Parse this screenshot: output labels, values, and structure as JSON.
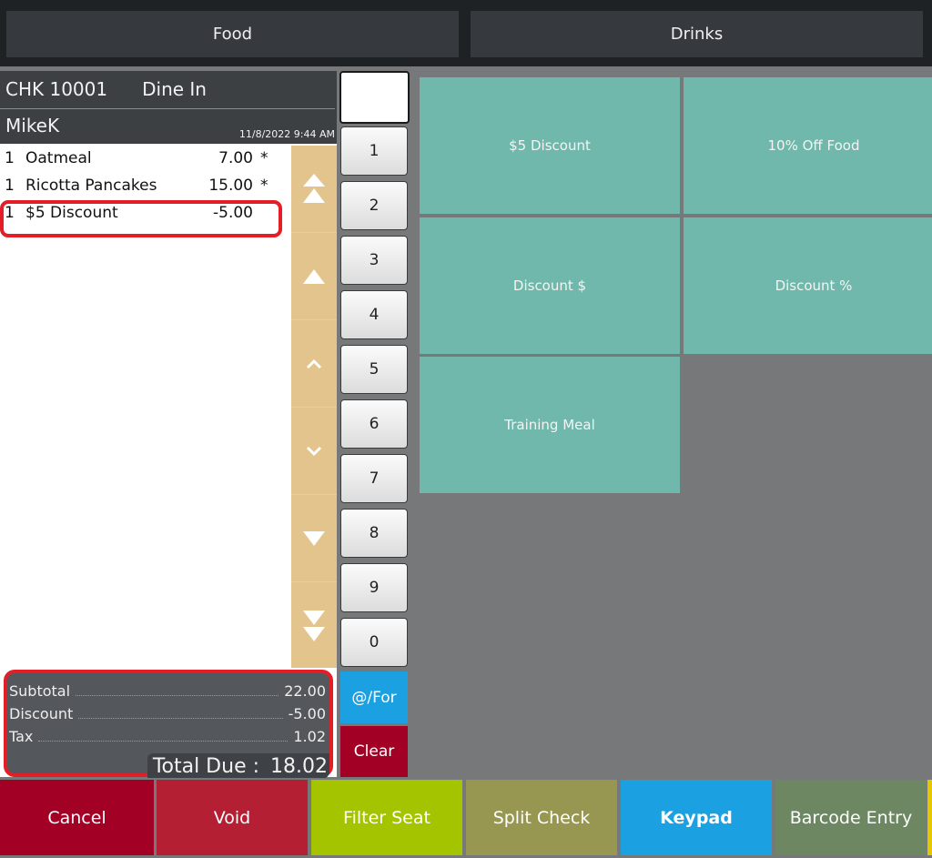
{
  "categories": {
    "food": "Food",
    "drinks": "Drinks"
  },
  "check": {
    "number": "CHK 10001",
    "order_type": "Dine In",
    "user": "MikeK",
    "datetime": "11/8/2022 9:44 AM",
    "items": [
      {
        "qty": "1",
        "name": "Oatmeal",
        "price": "7.00",
        "flag": "*"
      },
      {
        "qty": "1",
        "name": "Ricotta Pancakes",
        "price": "15.00",
        "flag": "*"
      },
      {
        "qty": "1",
        "name": "$5 Discount",
        "price": "-5.00",
        "flag": ""
      }
    ],
    "highlighted_item_index": 2
  },
  "scroll_buttons": [
    {
      "name": "page-top",
      "icon": "double-up-triangle-icon"
    },
    {
      "name": "page-up",
      "icon": "up-triangle-icon"
    },
    {
      "name": "line-up",
      "icon": "chevron-up-icon"
    },
    {
      "name": "line-down",
      "icon": "chevron-down-icon"
    },
    {
      "name": "page-down",
      "icon": "down-triangle-icon"
    },
    {
      "name": "page-bottom",
      "icon": "double-down-triangle-icon"
    }
  ],
  "totals": {
    "subtotal_label": "Subtotal",
    "subtotal": "22.00",
    "discount_label": "Discount",
    "discount": "-5.00",
    "tax_label": "Tax",
    "tax": "1.02",
    "total_due_label": "Total Due :",
    "total_due": "18.02"
  },
  "keypad": {
    "display_value": "",
    "keys": [
      "1",
      "2",
      "3",
      "4",
      "5",
      "6",
      "7",
      "8",
      "9",
      "0"
    ],
    "at_for": "@/For",
    "clear": "Clear"
  },
  "discounts": [
    "$5 Discount",
    "10% Off Food",
    "Discount $",
    "Discount %",
    "Training Meal"
  ],
  "bottom_buttons": [
    {
      "label": "Cancel",
      "color": "#a20025"
    },
    {
      "label": "Void",
      "color": "#b51f33"
    },
    {
      "label": "Filter Seat",
      "color": "#a4c400"
    },
    {
      "label": "Split Check",
      "color": "#989752"
    },
    {
      "label": "Keypad",
      "color": "#1ba0e2"
    },
    {
      "label": "Barcode Entry",
      "color": "#6c8762"
    }
  ],
  "colors": {
    "highlight": "#e31e26",
    "discount_tile": "#6fb8ab",
    "scroll_bar": "#e2c48c"
  }
}
